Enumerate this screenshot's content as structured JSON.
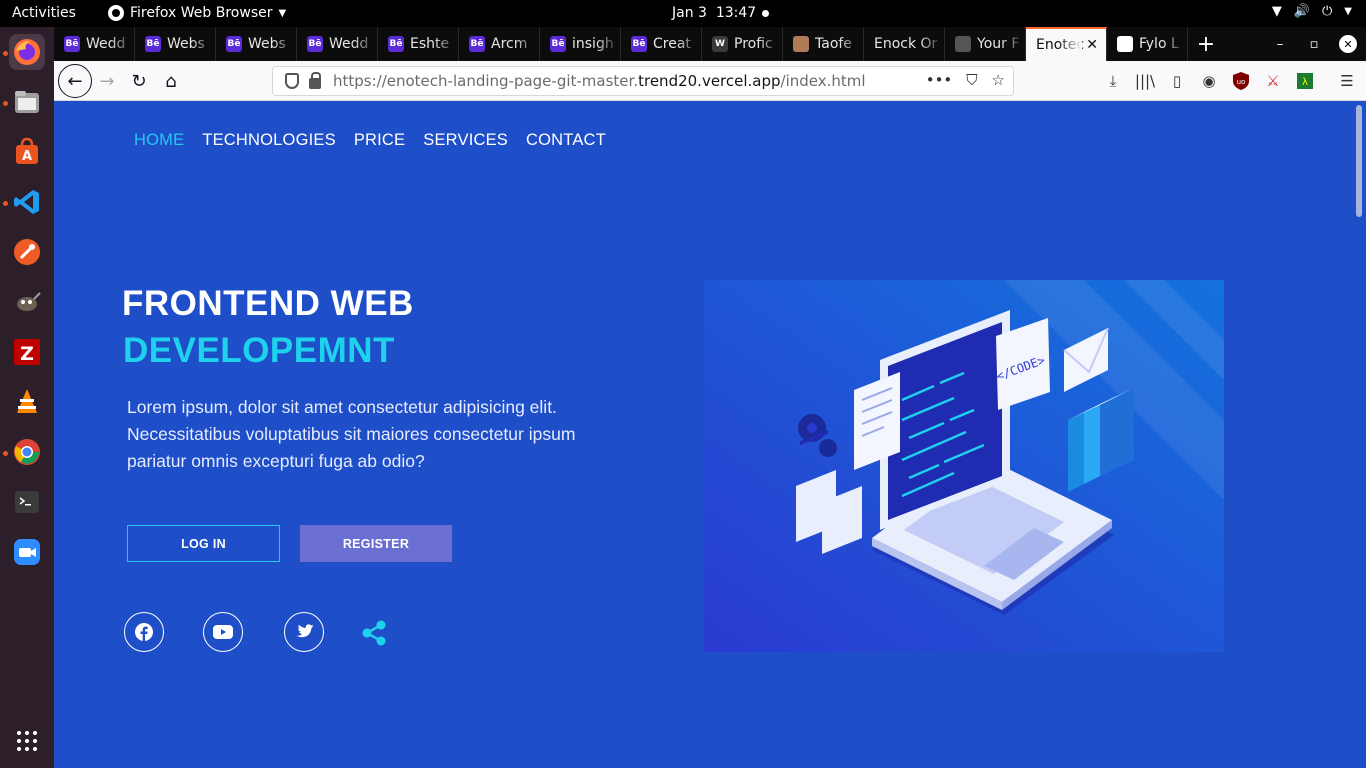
{
  "os": {
    "activities": "Activities",
    "app_menu": "Firefox Web Browser",
    "date": "Jan 3",
    "time": "13:47"
  },
  "browser": {
    "tabs": [
      {
        "label": "Wedd",
        "favicon": "Bē",
        "color": "#5b2bd8"
      },
      {
        "label": "Webs",
        "favicon": "Bē",
        "color": "#5b2bd8"
      },
      {
        "label": "Webs",
        "favicon": "Bē",
        "color": "#5b2bd8"
      },
      {
        "label": "Wedd",
        "favicon": "Bē",
        "color": "#5b2bd8"
      },
      {
        "label": "Eshte",
        "favicon": "Bē",
        "color": "#5b2bd8"
      },
      {
        "label": "Arcm",
        "favicon": "Bē",
        "color": "#5b2bd8"
      },
      {
        "label": "insigh",
        "favicon": "Bē",
        "color": "#5b2bd8"
      },
      {
        "label": "Creat",
        "favicon": "Bē",
        "color": "#5b2bd8"
      },
      {
        "label": "Profic",
        "favicon": "W",
        "color": "#3a3a3a"
      },
      {
        "label": "Taofe",
        "favicon": "",
        "color": "#b07a56"
      },
      {
        "label": "Enock Or",
        "favicon": "",
        "color": ""
      },
      {
        "label": "Your F",
        "favicon": "",
        "color": "#555555"
      },
      {
        "label": "Enotec",
        "favicon": "",
        "color": "",
        "active": true
      },
      {
        "label": "Fylo L",
        "favicon": "",
        "color": "#ffffff"
      }
    ],
    "url_prefix": "https://enotech-landing-page-git-master.",
    "url_host": "trend20.vercel.app",
    "url_path": "/index.html"
  },
  "page": {
    "nav": [
      "HOME",
      "TECHNOLOGIES",
      "PRICE",
      "SERVICES",
      "CONTACT"
    ],
    "title_line1": "FRONTEND WEB",
    "title_line2": "DEVELOPEMNT",
    "description": "Lorem ipsum, dolor sit amet consectetur adipisicing elit. Necessitatibus voluptatibus sit maiores consectetur ipsum pariatur omnis excepturi fuga ab odio?",
    "login_label": "LOG IN",
    "register_label": "REGISTER",
    "social": [
      "facebook-icon",
      "youtube-icon",
      "twitter-icon",
      "share-icon"
    ],
    "illustration_code_label": "</CODE>"
  },
  "colors": {
    "page_bg": "#1e4fc9",
    "accent": "#1fd2ec",
    "register_bg": "#6b6fd2"
  }
}
